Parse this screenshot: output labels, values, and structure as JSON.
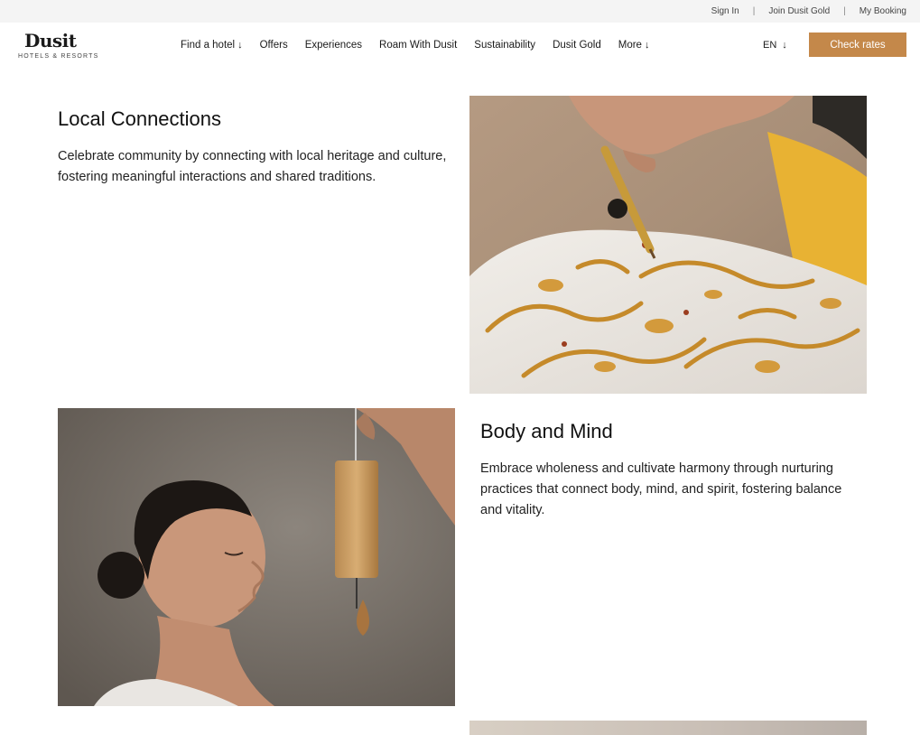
{
  "utility": {
    "sign_in": "Sign In",
    "join": "Join Dusit Gold",
    "booking": "My Booking",
    "separator": "|"
  },
  "header": {
    "logo_text": "Dusit",
    "logo_sub": "HOTELS & RESORTS",
    "nav": [
      {
        "label": "Find a hotel",
        "has_dropdown": true
      },
      {
        "label": "Offers",
        "has_dropdown": false
      },
      {
        "label": "Experiences",
        "has_dropdown": false
      },
      {
        "label": "Roam With Dusit",
        "has_dropdown": false
      },
      {
        "label": "Sustainability",
        "has_dropdown": false
      },
      {
        "label": "Dusit Gold",
        "has_dropdown": false
      },
      {
        "label": "More",
        "has_dropdown": true
      }
    ],
    "arrow_glyph": "↓",
    "language": "EN",
    "cta": "Check rates",
    "cta_color": "#c4884a"
  },
  "sections": [
    {
      "title": "Local Connections",
      "text": "Celebrate community by connecting with local heritage and culture, fostering meaningful interactions and shared traditions.",
      "image": "batik-painting-photo"
    },
    {
      "title": "Body and Mind",
      "text": "Embrace wholeness and cultivate harmony through nurturing practices that connect body, mind, and spirit, fostering balance and vitality.",
      "image": "woman-wind-chime-photo"
    }
  ]
}
